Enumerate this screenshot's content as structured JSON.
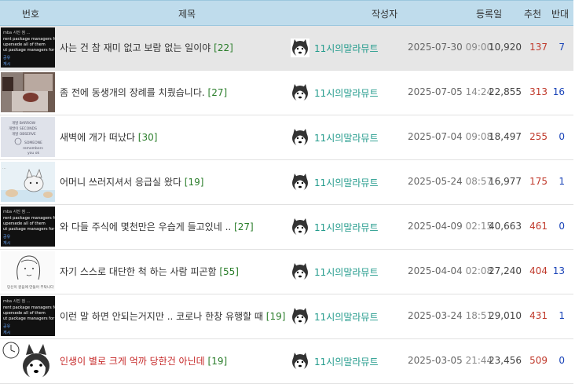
{
  "header": {
    "no": "번호",
    "title": "제목",
    "author": "작성자",
    "date": "등록일",
    "up": "추천",
    "down": "반대"
  },
  "rows": [
    {
      "title": "사는 건 참 재미 없고 보람 없는 일이야",
      "comments": "[22]",
      "author": "11시의말라뮤트",
      "date": "2025-07-30",
      "time": "09:00",
      "views": "10,920",
      "up": "137",
      "down": "7",
      "thumb": "code-screenshot"
    },
    {
      "title": "좀 전에 동생개의 장례를 치뤘습니다.",
      "comments": "[27]",
      "author": "11시의말라뮤트",
      "date": "2025-07-05",
      "time": "14:24",
      "views": "22,855",
      "up": "313",
      "down": "16",
      "thumb": "room-photo"
    },
    {
      "title": "새벽에 개가 떠났다",
      "comments": "[30]",
      "author": "11시의말라뮤트",
      "date": "2025-07-04",
      "time": "09:08",
      "views": "18,497",
      "up": "255",
      "down": "0",
      "thumb": "handwritten-note"
    },
    {
      "title": "어머니 쓰러지셔서 응급실 왔다",
      "comments": "[19]",
      "author": "11시의말라뮤트",
      "date": "2025-05-24",
      "time": "08:57",
      "views": "16,977",
      "up": "175",
      "down": "1",
      "thumb": "dog-drawing"
    },
    {
      "title": "와 다들 주식에 몇천만은 우습게 들고있네 ..",
      "comments": "[27]",
      "author": "11시의말라뮤트",
      "date": "2025-04-09",
      "time": "02:15",
      "views": "40,663",
      "up": "461",
      "down": "0",
      "thumb": "code-screenshot"
    },
    {
      "title": "자기 스스로 대단한 척 하는 사람 피곤함",
      "comments": "[55]",
      "author": "11시의말라뮤트",
      "date": "2025-04-04",
      "time": "02:08",
      "views": "27,240",
      "up": "404",
      "down": "13",
      "thumb": "sketch-face"
    },
    {
      "title": "이런 말 하면 안되는거지만 .. 코로나 한창 유행할 때",
      "comments": "[19]",
      "author": "11시의말라뮤트",
      "date": "2025-03-24",
      "time": "18:51",
      "views": "29,010",
      "up": "431",
      "down": "1",
      "thumb": "code-screenshot"
    },
    {
      "title": "인생이 별로 크게 억까 당한건 아닌데",
      "comments": "[19]",
      "author": "11시의말라뮤트",
      "date": "2025-03-05",
      "time": "21:44",
      "views": "23,456",
      "up": "509",
      "down": "0",
      "thumb": "husky-clock",
      "red": true
    }
  ],
  "colors": {
    "header_bg": "#bfdcec",
    "author": "#239b8c",
    "up": "#c0392b",
    "down": "#1a44b8",
    "comment_count": "#2a7d2a",
    "red_title": "#c62828"
  }
}
